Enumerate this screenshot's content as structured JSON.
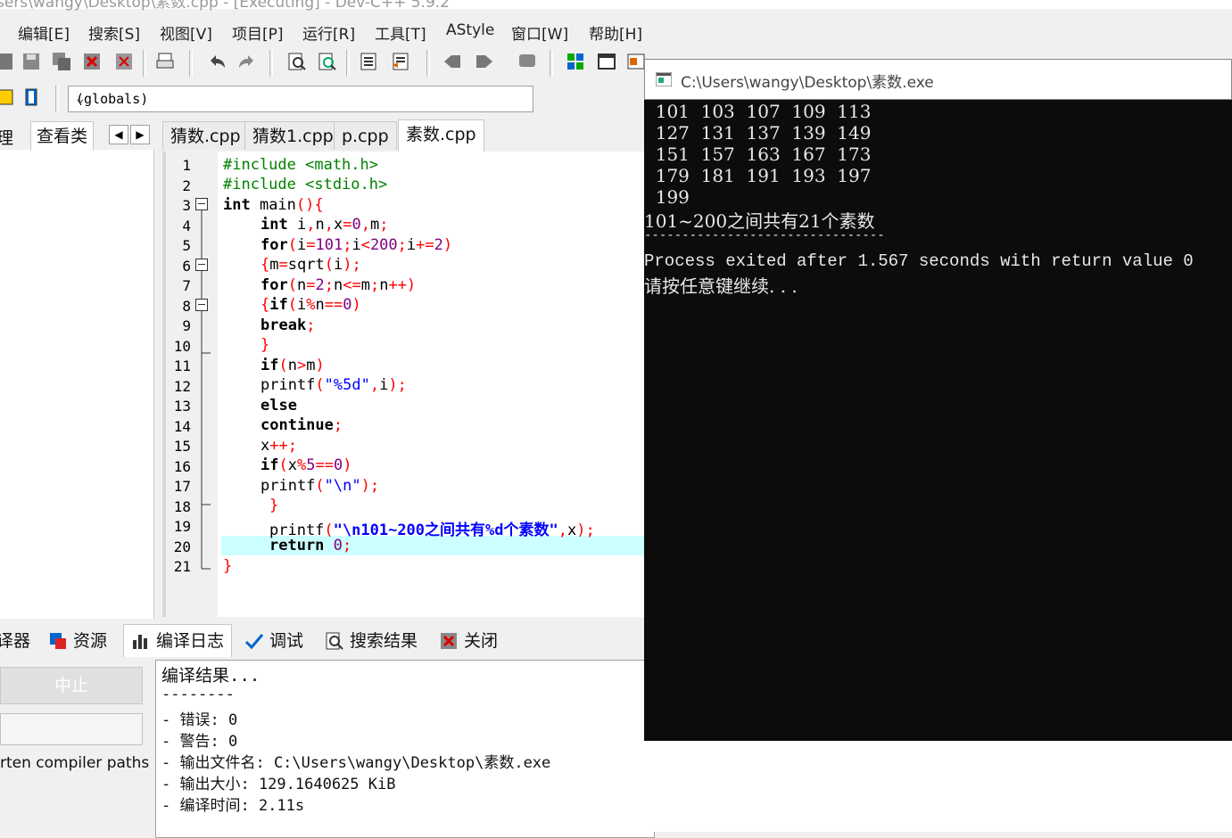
{
  "window": {
    "title": "sers\\wangy\\Desktop\\素数.cpp - [Executing] - Dev-C++ 5.9.2"
  },
  "menu": {
    "items": [
      "编辑[E]",
      "搜索[S]",
      "视图[V]",
      "项目[P]",
      "运行[R]",
      "工具[T]",
      "AStyle",
      "窗口[W]",
      "帮助[H]"
    ]
  },
  "scope_select": {
    "value": "(globals)"
  },
  "left_tabs": {
    "manage": "理",
    "class_view": "查看类"
  },
  "file_tabs": [
    "猜数.cpp",
    "猜数1.cpp",
    "p.cpp",
    "素数.cpp"
  ],
  "active_file_tab": 3,
  "code_lines": [
    "#include <math.h>",
    "#include <stdio.h>",
    "int main(){",
    "int i,n,x=0,m;",
    "for(i=101;i<200;i+=2)",
    "{m=sqrt(i);",
    "for(n=2;n<=m;n++)",
    "{if(i%n==0)",
    "break;",
    "}",
    "if(n>m)",
    "printf(\"%5d\",i);",
    "else",
    "continue;",
    "x++;",
    "if(x%5==0)",
    "printf(\"\\n\");",
    "}",
    "printf(\"\\n101~200之间共有%d个素数\",x);",
    "return 0;",
    "}"
  ],
  "line_numbers": [
    "1",
    "2",
    "3",
    "4",
    "5",
    "6",
    "7",
    "8",
    "9",
    "10",
    "11",
    "12",
    "13",
    "14",
    "15",
    "16",
    "17",
    "18",
    "19",
    "20",
    "21"
  ],
  "bottom_tabs": {
    "compiler": "译器",
    "resources": "资源",
    "compile_log": "编译日志",
    "debug": "调试",
    "search_results": "搜索结果",
    "close": "关闭"
  },
  "bottom_left": {
    "stop_button": "中止",
    "compiler_paths": "rten compiler paths"
  },
  "compile_log": [
    "编译结果...",
    "--------",
    "- 错误: 0",
    "- 警告: 0",
    "- 输出文件名: C:\\Users\\wangy\\Desktop\\素数.exe",
    "- 输出大小: 129.1640625 KiB",
    "- 编译时间: 2.11s"
  ],
  "console": {
    "title": "C:\\Users\\wangy\\Desktop\\素数.exe",
    "lines": [
      "  101  103  107  109  113",
      "  127  131  137  139  149",
      "  151  157  163  167  173",
      "  179  181  191  193  197",
      "  199",
      "101~200之间共有21个素数",
      "--------------------------------",
      "Process exited after 1.567 seconds with return value 0",
      "请按任意键继续. . ."
    ]
  }
}
